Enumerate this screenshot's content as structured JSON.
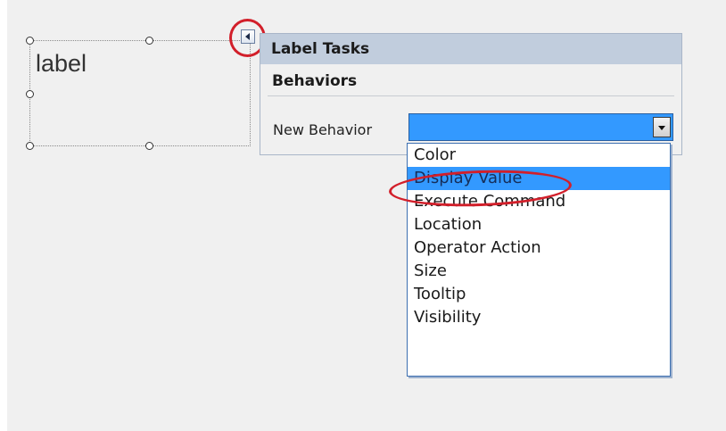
{
  "designer": {
    "label_text": "label"
  },
  "tasks_panel": {
    "title": "Label Tasks",
    "section": "Behaviors",
    "field_label": "New Behavior",
    "field_value": ""
  },
  "dropdown": {
    "options": [
      "Color",
      "Display Value",
      "Execute Command",
      "Location",
      "Operator Action",
      "Size",
      "Tooltip",
      "Visibility"
    ],
    "selected": "Display Value"
  },
  "colors": {
    "selection": "#3399ff",
    "header": "#c1cddd",
    "annotation": "#d21f2a"
  },
  "icons": {
    "smart_tag": "smart-tag-arrow-icon",
    "dropdown_arrow": "chevron-down-icon"
  }
}
